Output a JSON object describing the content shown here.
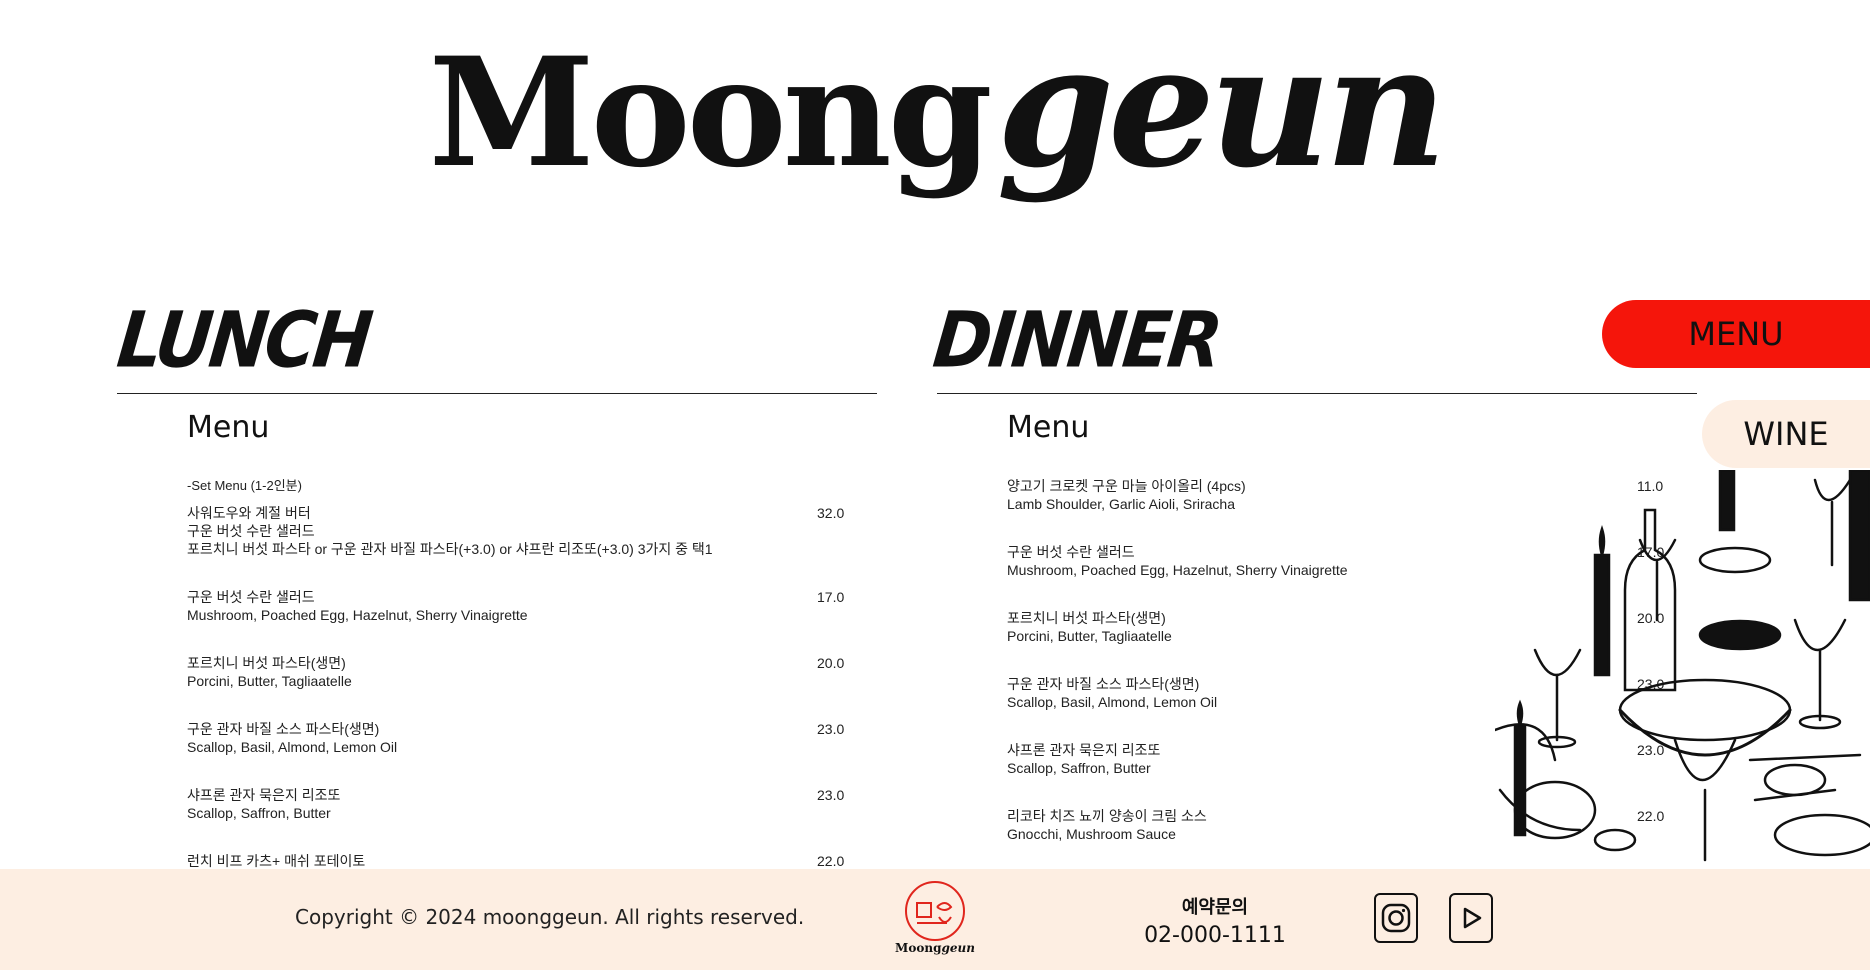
{
  "logo": {
    "caps": "Moong",
    "script": "geun"
  },
  "lunch": {
    "title": "LUNCH",
    "menu_heading": "Menu",
    "set": {
      "note": "-Set Menu (1-2인분)",
      "lines": [
        "사워도우와 계절 버터",
        "구운 버섯 수란 샐러드",
        "포르치니 버섯 파스타 or 구운 관자 바질 파스타(+3.0) or 샤프란 리조또(+3.0) 3가지 중 택1"
      ],
      "price": "32.0"
    },
    "items": [
      {
        "name": "구운 버섯 수란 샐러드",
        "desc": "Mushroom, Poached Egg, Hazelnut, Sherry Vinaigrette",
        "price": "17.0"
      },
      {
        "name": "포르치니 버섯 파스타(생면)",
        "desc": "Porcini, Butter, Tagliaatelle",
        "price": "20.0"
      },
      {
        "name": "구운 관자 바질 소스 파스타(생면)",
        "desc": "Scallop, Basil, Almond, Lemon Oil",
        "price": "23.0"
      },
      {
        "name": "샤프론 관자 묵은지 리조또",
        "desc": "Scallop, Saffron, Butter",
        "price": "23.0"
      },
      {
        "name": "런치 비프 카츠+ 매쉬 포테이토",
        "desc": "",
        "price": "22.0"
      }
    ]
  },
  "dinner": {
    "title": "DINNER",
    "menu_heading": "Menu",
    "items": [
      {
        "name": "양고기 크로켓 구운 마늘 아이올리 (4pcs)",
        "desc": "Lamb Shoulder, Garlic Aioli, Sriracha",
        "price": "11.0"
      },
      {
        "name": "구운 버섯 수란 샐러드",
        "desc": "Mushroom, Poached Egg, Hazelnut, Sherry Vinaigrette",
        "price": "17.0"
      },
      {
        "name": "포르치니 버섯 파스타(생면)",
        "desc": "Porcini, Butter, Tagliaatelle",
        "price": "20.0"
      },
      {
        "name": "구운 관자 바질 소스 파스타(생면)",
        "desc": "Scallop, Basil, Almond, Lemon Oil",
        "price": "23.0"
      },
      {
        "name": "샤프론 관자 묵은지 리조또",
        "desc": "Scallop, Saffron, Butter",
        "price": "23.0"
      },
      {
        "name": "리코타 치즈 뇨끼 양송이 크림 소스",
        "desc": "Gnocchi, Mushroom Sauce",
        "price": "22.0"
      }
    ]
  },
  "tabs": {
    "menu": "MENU",
    "wine": "WINE"
  },
  "colors": {
    "menu_tab": "#f5150b",
    "footer_bg": "#fdeee2",
    "logo_red": "#e0261d"
  },
  "footer": {
    "copyright": "Copyright © 2024 moonggeun. All rights reserved.",
    "logo_caps": "Moong",
    "logo_script": "geun",
    "reservation_label": "예약문의",
    "phone": "02-000-1111",
    "icons": [
      "instagram-icon",
      "youtube-icon"
    ]
  }
}
